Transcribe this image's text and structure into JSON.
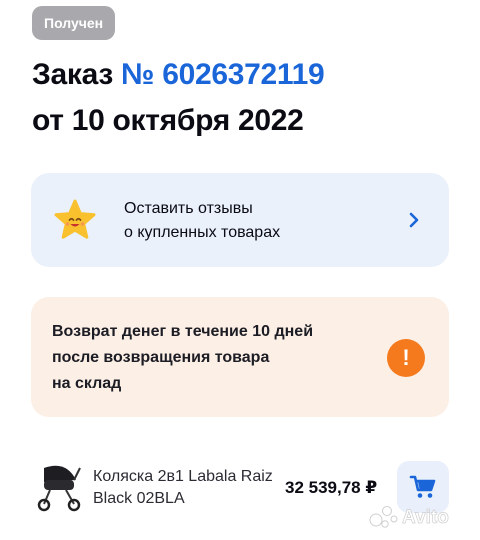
{
  "status_badge": "Получен",
  "order": {
    "title_prefix": "Заказ",
    "number": "№ 6026372119",
    "date_line": "от 10 октября 2022"
  },
  "review_card": {
    "line1": "Оставить отзывы",
    "line2": "о купленных товарах",
    "icon": "smiling-star-icon"
  },
  "refund_card": {
    "line1": "Возврат денег в течение 10 дней",
    "line2": "после возвращения товара",
    "line3": "на склад",
    "icon": "exclamation-icon"
  },
  "product": {
    "name_line1": "Коляска 2в1 Labala Raiz",
    "name_line2": "Black 02BLA",
    "price": "32 539,78 ₽",
    "cart_icon": "cart-icon"
  },
  "watermark": {
    "text": "Avito"
  },
  "colors": {
    "accent_blue": "#1a66d9",
    "badge_gray": "#a8a8ad",
    "review_bg": "#eaf1fb",
    "refund_bg": "#fcefe6",
    "warning_orange": "#f57a1d",
    "star_yellow": "#f9c12e"
  }
}
